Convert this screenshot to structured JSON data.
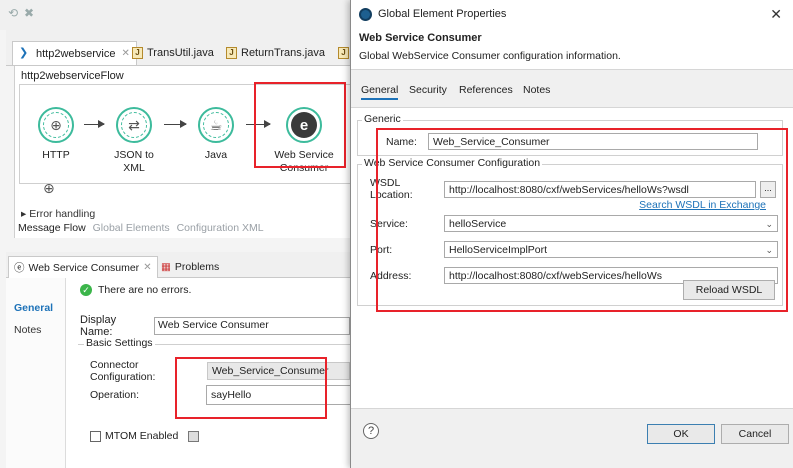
{
  "editor": {
    "tabs": [
      {
        "label": "http2webservice"
      },
      {
        "label": "TransUtil.java"
      },
      {
        "label": "ReturnTrans.java"
      }
    ],
    "flow_name": "http2webserviceFlow",
    "nodes": [
      {
        "label": "HTTP"
      },
      {
        "label": "JSON to XML"
      },
      {
        "label": "Java"
      },
      {
        "label": "Web Service Consumer"
      }
    ],
    "error_handling": "Error handling",
    "message_flow_tabs": [
      "Message Flow",
      "Global Elements",
      "Configuration XML"
    ]
  },
  "properties": {
    "tabs": [
      {
        "label": "Web Service Consumer"
      },
      {
        "label": "Problems"
      }
    ],
    "side_items": [
      "General",
      "Notes"
    ],
    "status": "There are no errors.",
    "display_name_label": "Display Name:",
    "display_name_value": "Web Service Consumer",
    "basic_settings_label": "Basic Settings",
    "connector_label": "Connector Configuration:",
    "connector_value": "Web_Service_Consumer",
    "operation_label": "Operation:",
    "operation_value": "sayHello",
    "mtom_label": "MTOM Enabled"
  },
  "dialog": {
    "title": "Global Element Properties",
    "header_title": "Web Service Consumer",
    "header_desc": "Global WebService Consumer configuration information.",
    "tabs": [
      "General",
      "Security",
      "References",
      "Notes"
    ],
    "generic_group": "Generic",
    "name_label": "Name:",
    "name_value": "Web_Service_Consumer",
    "config_group": "Web Service Consumer Configuration",
    "wsdl_label": "WSDL Location:",
    "wsdl_value": "http://localhost:8080/cxf/webServices/helloWs?wsdl",
    "browse_label": "...",
    "search_link": "Search WSDL in Exchange",
    "service_label": "Service:",
    "service_value": "helloService",
    "port_label": "Port:",
    "port_value": "HelloServiceImplPort",
    "address_label": "Address:",
    "address_value": "http://localhost:8080/cxf/webServices/helloWs",
    "reload_label": "Reload WSDL",
    "ok_label": "OK",
    "cancel_label": "Cancel"
  },
  "colors": {
    "highlight": "#e8222a",
    "accent": "#1d72b8",
    "node_ring": "#3dbb9c"
  }
}
